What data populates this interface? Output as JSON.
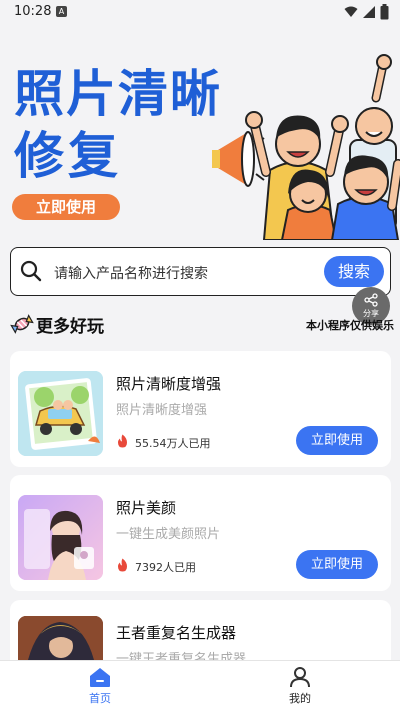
{
  "status_bar": {
    "time": "10:28",
    "notification_glyph": "A"
  },
  "banner": {
    "title_line1": "照片清晰",
    "title_line2": "修复",
    "button_label": "立即使用",
    "title_color": "#1f5fd6",
    "button_color": "#f07d3d"
  },
  "search": {
    "placeholder": "请输入产品名称进行搜索",
    "button_label": "搜索"
  },
  "share_float": {
    "label": "分享"
  },
  "section": {
    "title": "更多好玩",
    "note": "本小程序仅供娱乐"
  },
  "cards": [
    {
      "title": "照片清晰度增强",
      "desc": "照片清晰度增强",
      "count": "55.54万人已用",
      "button_label": "立即使用",
      "icon": "fire-icon"
    },
    {
      "title": "照片美颜",
      "desc": "一键生成美颜照片",
      "count": "7392人已用",
      "button_label": "立即使用",
      "icon": "fire-icon"
    },
    {
      "title": "王者重复名生成器",
      "desc": "一键王者重复名生成器",
      "count": "",
      "button_label": "",
      "icon": "fire-icon"
    }
  ],
  "tab_bar": {
    "tabs": [
      {
        "label": "首页",
        "icon": "home-icon",
        "active": true
      },
      {
        "label": "我的",
        "icon": "profile-icon",
        "active": false
      }
    ],
    "active_color": "#3b74f2"
  },
  "accent_color": "#3b74f2"
}
